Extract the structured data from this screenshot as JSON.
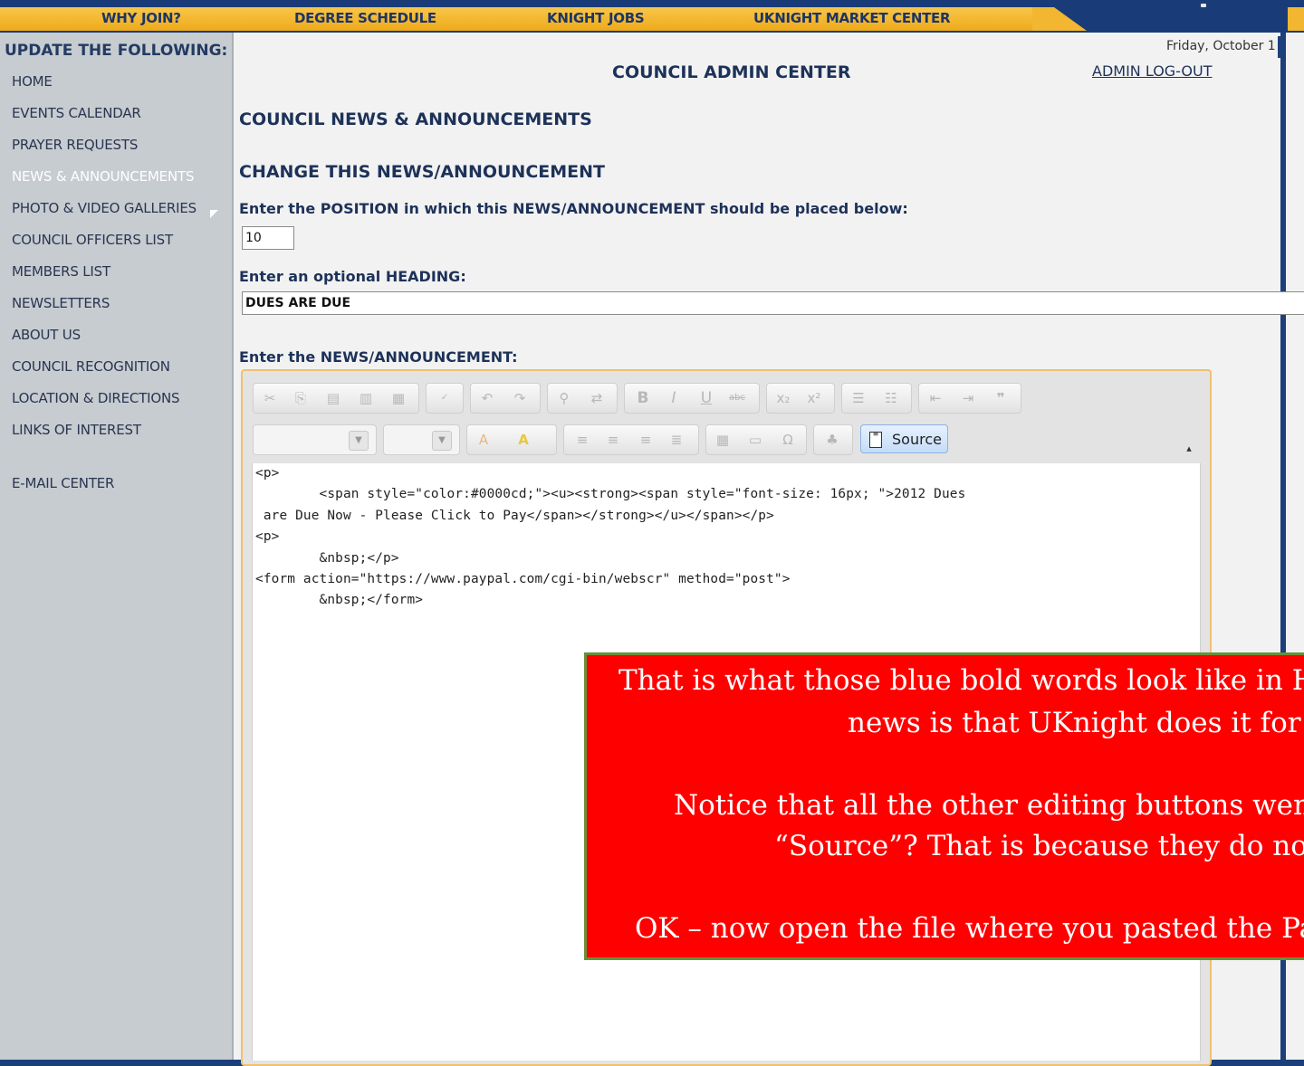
{
  "nav": {
    "items": [
      "WHY JOIN?",
      "DEGREE SCHEDULE",
      "KNIGHT JOBS",
      "UKNIGHT MARKET CENTER"
    ]
  },
  "sidebar": {
    "heading": "UPDATE THE FOLLOWING:",
    "items": [
      {
        "label": "HOME"
      },
      {
        "label": "EVENTS CALENDAR"
      },
      {
        "label": "PRAYER REQUESTS"
      },
      {
        "label": "NEWS & ANNOUNCEMENTS"
      },
      {
        "label": "PHOTO & VIDEO GALLERIES"
      },
      {
        "label": "COUNCIL OFFICERS LIST"
      },
      {
        "label": "MEMBERS LIST"
      },
      {
        "label": "NEWSLETTERS"
      },
      {
        "label": "ABOUT US"
      },
      {
        "label": "COUNCIL RECOGNITION"
      },
      {
        "label": "LOCATION & DIRECTIONS"
      },
      {
        "label": "LINKS OF INTEREST"
      },
      {
        "label": "E-MAIL CENTER"
      }
    ],
    "active_index": 3
  },
  "header": {
    "date": "Friday, October 1",
    "title": "COUNCIL ADMIN CENTER",
    "logout": "ADMIN LOG-OUT"
  },
  "form": {
    "section_title": "COUNCIL NEWS & ANNOUNCEMENTS",
    "subsection_title": "CHANGE THIS NEWS/ANNOUNCEMENT",
    "position_label": "Enter the POSITION in which this NEWS/ANNOUNCEMENT should be placed below:",
    "position_value": "10",
    "heading_label": "Enter an optional HEADING:",
    "heading_value": "DUES ARE DUE",
    "announcement_label": "Enter the NEWS/ANNOUNCEMENT:"
  },
  "editor": {
    "source_label": "Source",
    "toolbar_icons": [
      "cut-icon",
      "copy-icon",
      "paste-icon",
      "paste-text-icon",
      "paste-word-icon",
      "spellcheck-icon",
      "undo-icon",
      "redo-icon",
      "find-icon",
      "replace-icon",
      "bold-icon",
      "italic-icon",
      "underline-icon",
      "strike-icon",
      "subscript-icon",
      "superscript-icon",
      "numbered-list-icon",
      "bullet-list-icon",
      "outdent-icon",
      "indent-icon",
      "blockquote-icon",
      "font-color-icon",
      "bg-color-icon",
      "align-left-icon",
      "align-center-icon",
      "align-right-icon",
      "justify-icon",
      "table-icon",
      "hr-icon",
      "special-char-icon",
      "spellcheck-user-icon",
      "source-icon"
    ],
    "code_lines": [
      "<p>",
      "        <span style=\"color:#0000cd;\"><u><strong><span style=\"font-size: 16px; \">2012 Dues",
      " are Due Now - Please Click to Pay</span></strong></u></span></p>",
      "<p>",
      "        &nbsp;</p>",
      "<form action=\"https://www.paypal.com/cgi-bin/webscr\" method=\"post\">",
      "        &nbsp;</form>"
    ]
  },
  "callout": {
    "line1": "That is what those blue bold words look like in H",
    "line2": "news is that UKnight does it for y",
    "line3": "Notice that all the other editing buttons wen",
    "line4": "“Source”? That is because they do not wo",
    "line5": "OK – now open the file where you pasted the Pa",
    "colors": {
      "background": "#ff0000",
      "border": "#6a8f3a",
      "text": "#ffffff"
    }
  }
}
